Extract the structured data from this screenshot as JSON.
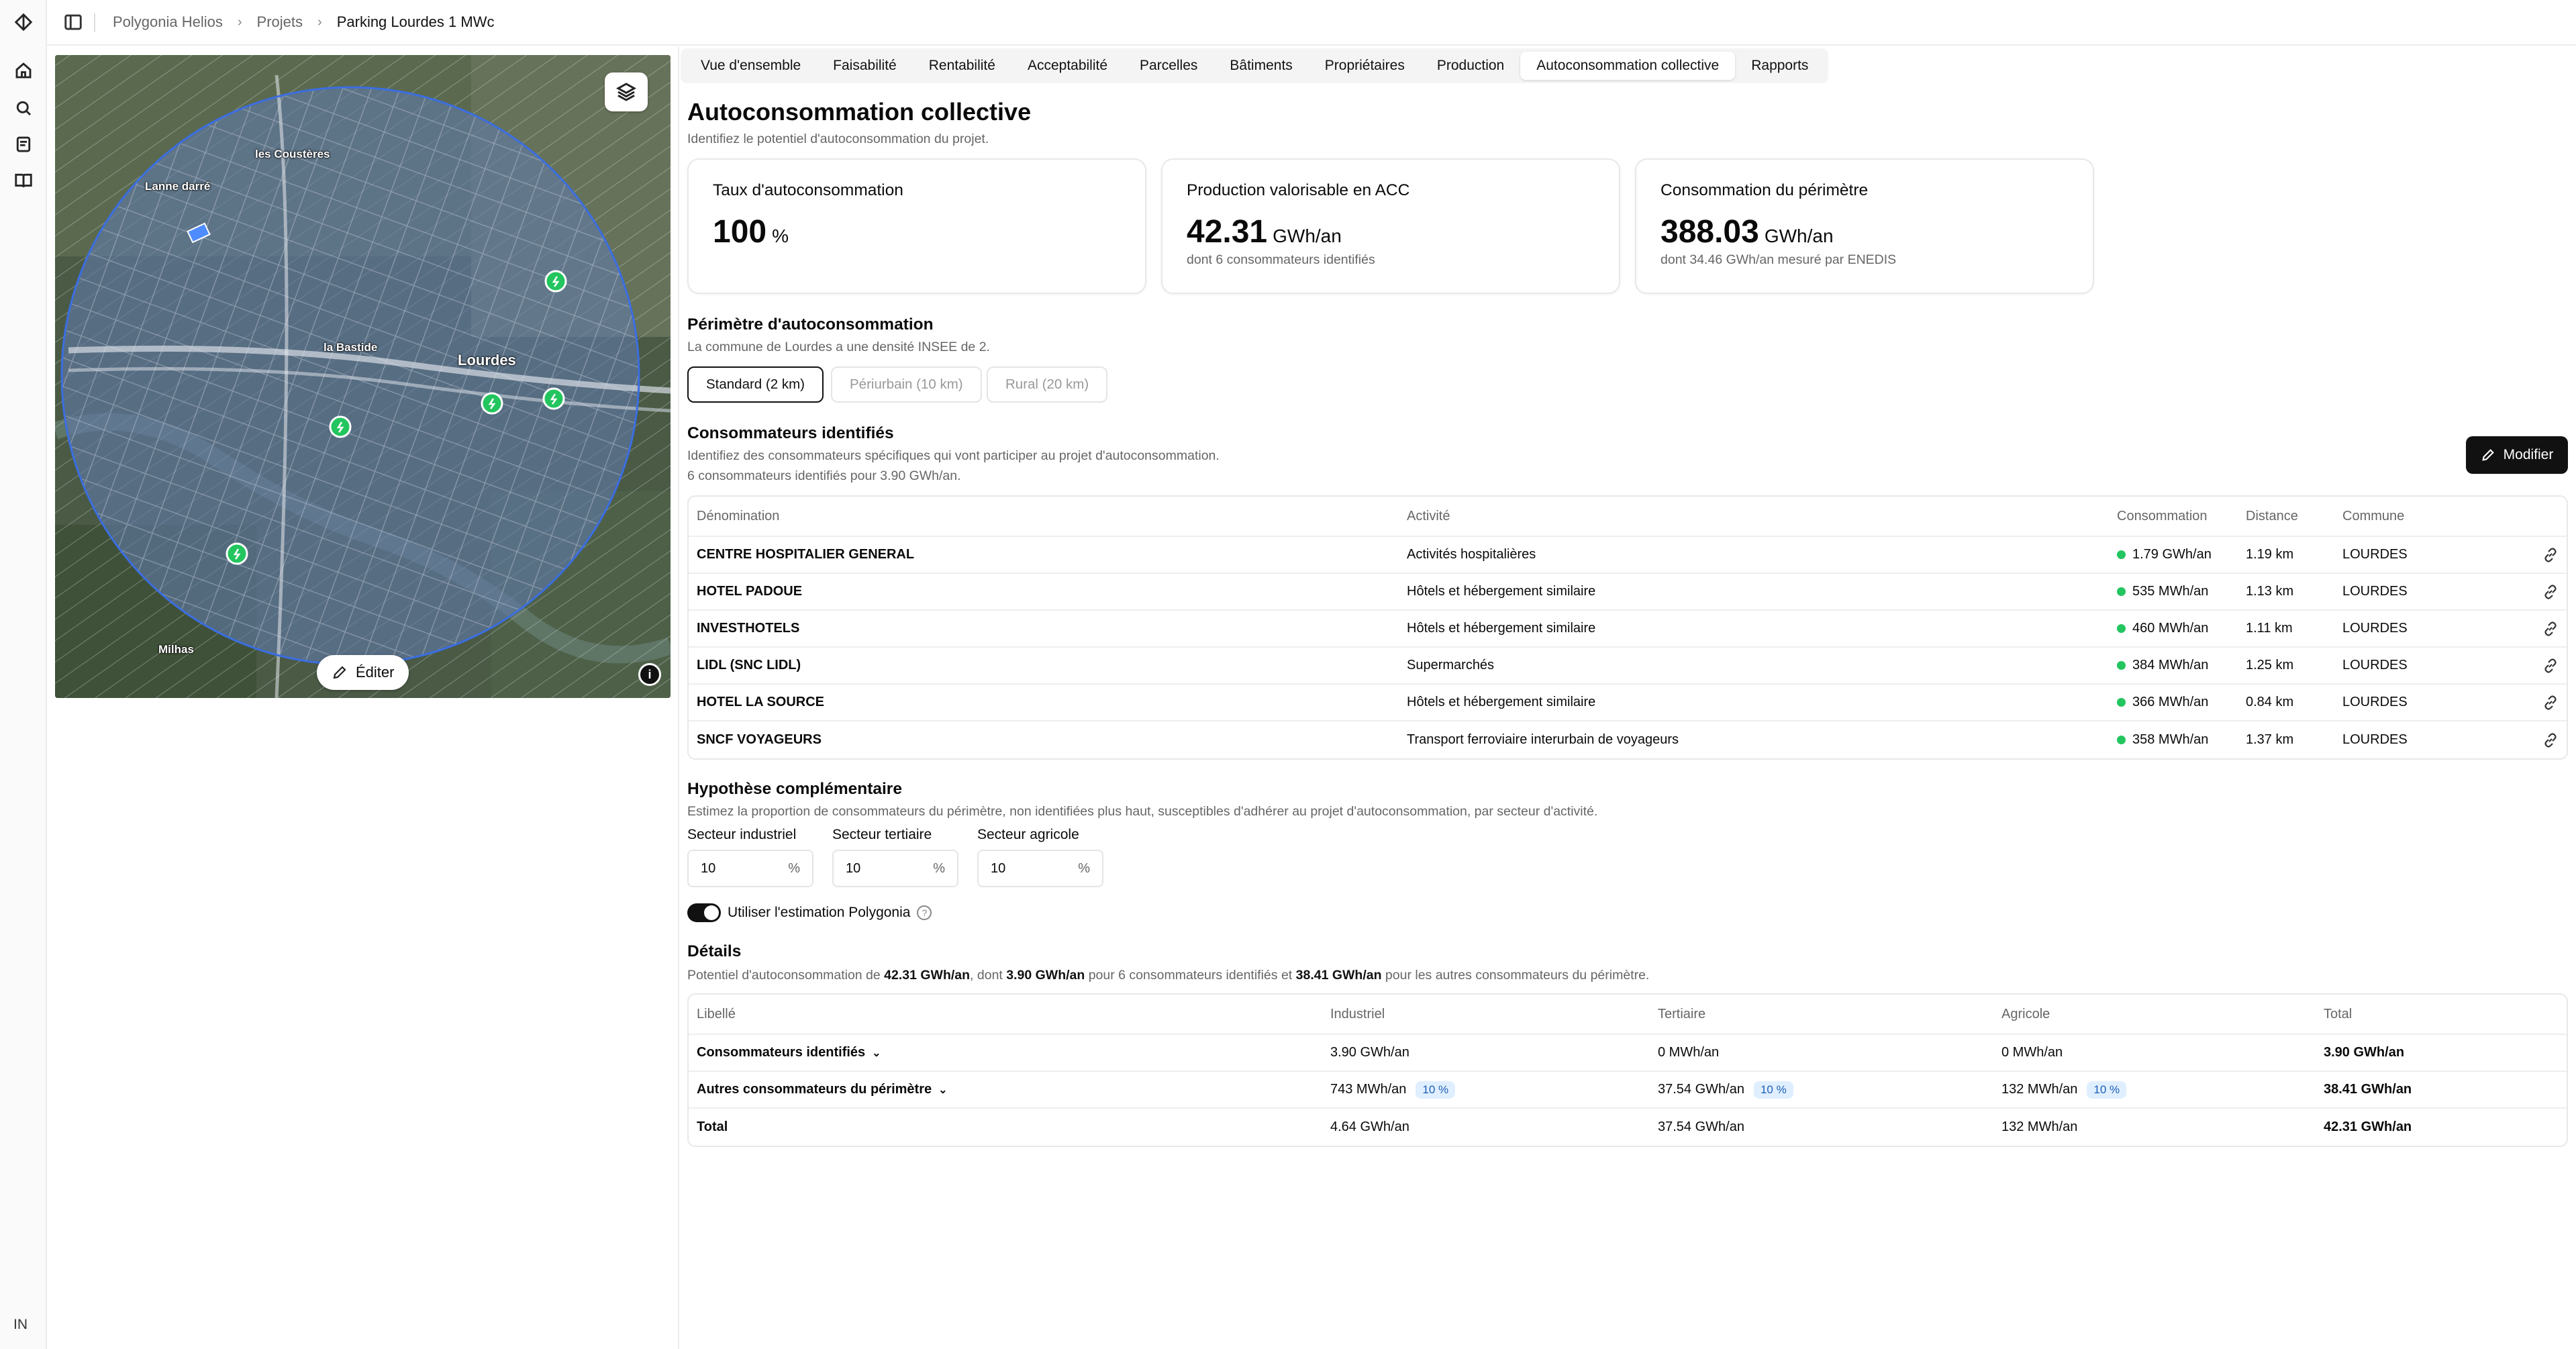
{
  "sidebar": {
    "user_initials": "IN"
  },
  "breadcrumb": {
    "items": [
      "Polygonia Helios",
      "Projets",
      "Parking Lourdes 1 MWc"
    ]
  },
  "map": {
    "labels": [
      "les Coustères",
      "Lanne darré",
      "la Bastide",
      "Lourdes",
      "Milhas"
    ],
    "edit_label": "Éditer",
    "info": "i"
  },
  "tabs": [
    "Vue d'ensemble",
    "Faisabilité",
    "Rentabilité",
    "Acceptabilité",
    "Parcelles",
    "Bâtiments",
    "Propriétaires",
    "Production",
    "Autoconsommation collective",
    "Rapports"
  ],
  "active_tab": "Autoconsommation collective",
  "page": {
    "title": "Autoconsommation collective",
    "subtitle": "Identifiez le potentiel d'autoconsommation du projet."
  },
  "cards": [
    {
      "title": "Taux d'autoconsommation",
      "value": "100",
      "unit": "%",
      "sub": ""
    },
    {
      "title": "Production valorisable en ACC",
      "value": "42.31",
      "unit": "GWh/an",
      "sub": "dont 6 consommateurs identifiés"
    },
    {
      "title": "Consommation du périmètre",
      "value": "388.03",
      "unit": "GWh/an",
      "sub": "dont 34.46 GWh/an mesuré par ENEDIS"
    }
  ],
  "perimeter": {
    "title": "Périmètre d'autoconsommation",
    "subtitle": "La commune de Lourdes a une densité INSEE de 2.",
    "options": [
      "Standard (2 km)",
      "Périurbain (10 km)",
      "Rural (20 km)"
    ],
    "selected": "Standard (2 km)"
  },
  "consumers": {
    "title": "Consommateurs identifiés",
    "desc1": "Identifiez des consommateurs spécifiques qui vont participer au projet d'autoconsommation.",
    "desc2": "6 consommateurs identifiés pour 3.90 GWh/an.",
    "modify_label": "Modifier",
    "columns": [
      "Dénomination",
      "Activité",
      "Consommation",
      "Distance",
      "Commune"
    ],
    "rows": [
      {
        "name": "CENTRE HOSPITALIER GENERAL",
        "activity": "Activités hospitalières",
        "consumption": "1.79 GWh/an",
        "distance": "1.19 km",
        "commune": "LOURDES"
      },
      {
        "name": "HOTEL PADOUE",
        "activity": "Hôtels et hébergement similaire",
        "consumption": "535 MWh/an",
        "distance": "1.13 km",
        "commune": "LOURDES"
      },
      {
        "name": "INVESTHOTELS",
        "activity": "Hôtels et hébergement similaire",
        "consumption": "460 MWh/an",
        "distance": "1.11 km",
        "commune": "LOURDES"
      },
      {
        "name": "LIDL (SNC LIDL)",
        "activity": "Supermarchés",
        "consumption": "384 MWh/an",
        "distance": "1.25 km",
        "commune": "LOURDES"
      },
      {
        "name": "HOTEL LA SOURCE",
        "activity": "Hôtels et hébergement similaire",
        "consumption": "366 MWh/an",
        "distance": "0.84 km",
        "commune": "LOURDES"
      },
      {
        "name": "SNCF VOYAGEURS",
        "activity": "Transport ferroviaire interurbain de voyageurs",
        "consumption": "358 MWh/an",
        "distance": "1.37 km",
        "commune": "LOURDES"
      }
    ]
  },
  "hypothesis": {
    "title": "Hypothèse complémentaire",
    "desc": "Estimez la proportion de consommateurs du périmètre, non identifiées plus haut, susceptibles d'adhérer au projet d'autoconsommation, par secteur d'activité.",
    "fields": [
      {
        "label": "Secteur industriel",
        "value": "10",
        "unit": "%"
      },
      {
        "label": "Secteur tertiaire",
        "value": "10",
        "unit": "%"
      },
      {
        "label": "Secteur agricole",
        "value": "10",
        "unit": "%"
      }
    ],
    "toggle_label": "Utiliser l'estimation Polygonia",
    "toggle_on": true,
    "help": "?"
  },
  "details": {
    "title": "Détails",
    "desc": {
      "p1": "Potentiel d'autoconsommation de ",
      "v1": "42.31 GWh/an",
      "p2": ", dont ",
      "v2": "3.90 GWh/an",
      "p3": " pour 6 consommateurs identifiés et ",
      "v3": "38.41 GWh/an",
      "p4": " pour les autres consommateurs du périmètre."
    },
    "columns": [
      "Libellé",
      "Industriel",
      "Tertiaire",
      "Agricole",
      "Total"
    ],
    "rows": [
      {
        "label": "Consommateurs identifiés",
        "industriel": "3.90 GWh/an",
        "ind_badge": "",
        "tertiaire": "0 MWh/an",
        "ter_badge": "",
        "agricole": "0 MWh/an",
        "agr_badge": "",
        "total": "3.90 GWh/an"
      },
      {
        "label": "Autres consommateurs du périmètre",
        "industriel": "743 MWh/an",
        "ind_badge": "10 %",
        "tertiaire": "37.54 GWh/an",
        "ter_badge": "10 %",
        "agricole": "132 MWh/an",
        "agr_badge": "10 %",
        "total": "38.41 GWh/an"
      },
      {
        "label": "Total",
        "industriel": "4.64 GWh/an",
        "ind_badge": "",
        "tertiaire": "37.54 GWh/an",
        "ter_badge": "",
        "agricole": "132 MWh/an",
        "agr_badge": "",
        "total": "42.31 GWh/an"
      }
    ]
  }
}
